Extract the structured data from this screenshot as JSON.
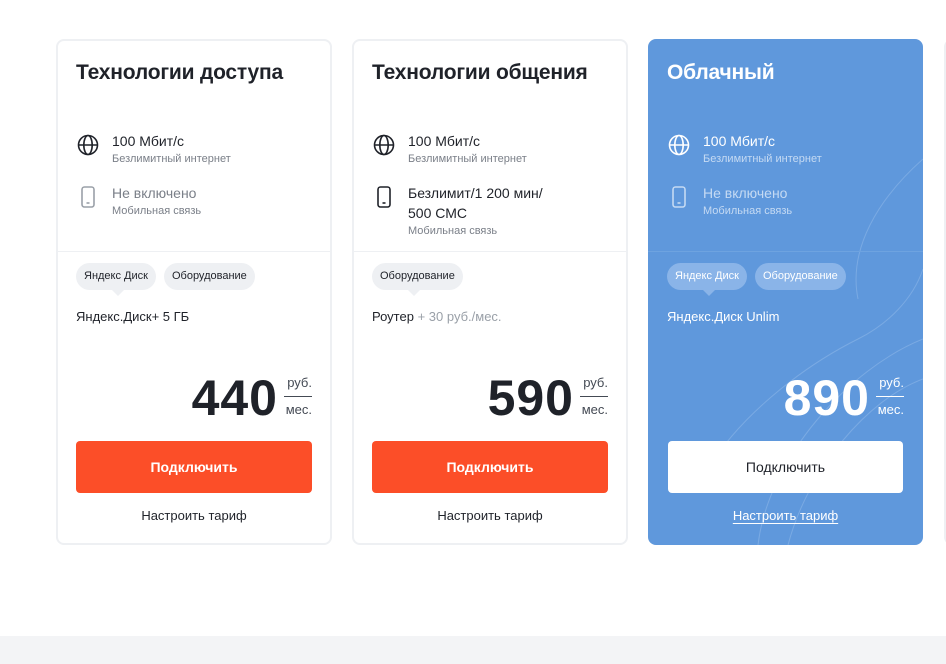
{
  "colors": {
    "accent_button": "#fc4e28",
    "highlight_card": "#5f98dc",
    "text": "#1f2229",
    "muted": "#7a7f88"
  },
  "cards": [
    {
      "title": "Технологии доступа",
      "features": [
        {
          "icon": "globe-icon",
          "main": "100 Мбит/с",
          "sub": "Безлимитный интернет"
        },
        {
          "icon": "phone-icon",
          "main": "Не включено",
          "sub": "Мобильная связь"
        }
      ],
      "chips": [
        "Яндекс Диск",
        "Оборудование"
      ],
      "extra": "Яндекс.Диск+ 5 ГБ",
      "extra_muted": "",
      "price": "440",
      "currency": "руб.",
      "period": "мес.",
      "button": "Подключить",
      "link": "Настроить тариф"
    },
    {
      "title": "Технологии общения",
      "features": [
        {
          "icon": "globe-icon",
          "main": "100 Мбит/с",
          "sub": "Безлимитный интернет"
        },
        {
          "icon": "phone-icon",
          "main": "Безлимит/1 200 мин/",
          "main2": "500 СМС",
          "sub": "Мобильная связь"
        }
      ],
      "chips": [
        "Оборудование"
      ],
      "extra": "Роутер",
      "extra_muted": "+ 30 руб./мес.",
      "price": "590",
      "currency": "руб.",
      "period": "мес.",
      "button": "Подключить",
      "link": "Настроить тариф"
    },
    {
      "title": "Облачный",
      "features": [
        {
          "icon": "globe-icon",
          "main": "100 Мбит/с",
          "sub": "Безлимитный интернет"
        },
        {
          "icon": "phone-icon",
          "main": "Не включено",
          "sub": "Мобильная связь"
        }
      ],
      "chips": [
        "Яндекс Диск",
        "Оборудование"
      ],
      "extra": "Яндекс.Диск Unlim",
      "extra_muted": "",
      "price": "890",
      "currency": "руб.",
      "period": "мес.",
      "button": "Подключить",
      "link": "Настроить тариф"
    }
  ]
}
